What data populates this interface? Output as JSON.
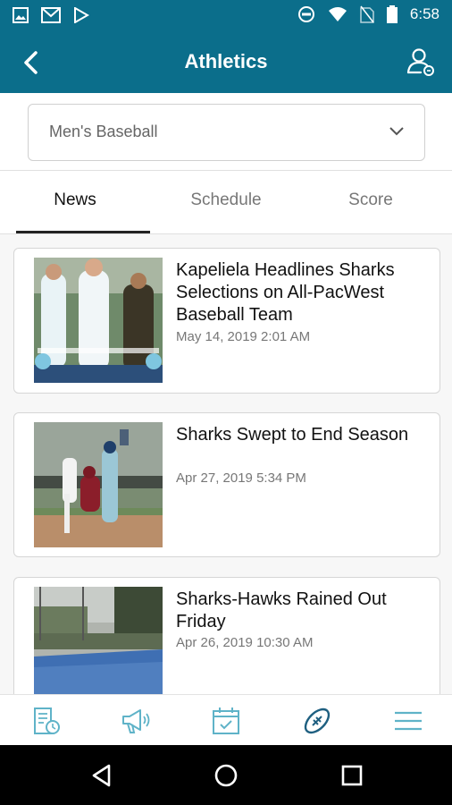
{
  "status_bar": {
    "time": "6:58",
    "left_icons": [
      "gallery-icon",
      "gmail-icon",
      "play-store-icon"
    ],
    "right_icons": [
      "do-not-disturb-icon",
      "wifi-icon",
      "no-sim-icon",
      "battery-icon"
    ]
  },
  "header": {
    "title": "Athletics",
    "bg_color": "#0b6e8b"
  },
  "filter": {
    "selected": "Men's Baseball"
  },
  "tabs": [
    {
      "label": "News",
      "active": true
    },
    {
      "label": "Schedule",
      "active": false
    },
    {
      "label": "Score",
      "active": false
    }
  ],
  "articles": [
    {
      "headline": "Kapeliela Headlines Sharks Selections on All-PacWest Baseball Team",
      "date": "May 14, 2019 2:01 AM"
    },
    {
      "headline": "Sharks Swept to End Season",
      "date": "Apr 27, 2019 5:34 PM"
    },
    {
      "headline": "Sharks-Hawks Rained Out Friday",
      "date": "Apr 26, 2019 10:30 AM"
    }
  ],
  "bottom_nav": {
    "items": [
      "news-icon",
      "announcements-icon",
      "calendar-icon",
      "athletics-icon",
      "menu-icon"
    ],
    "accent_color": "#5fb3c8"
  }
}
